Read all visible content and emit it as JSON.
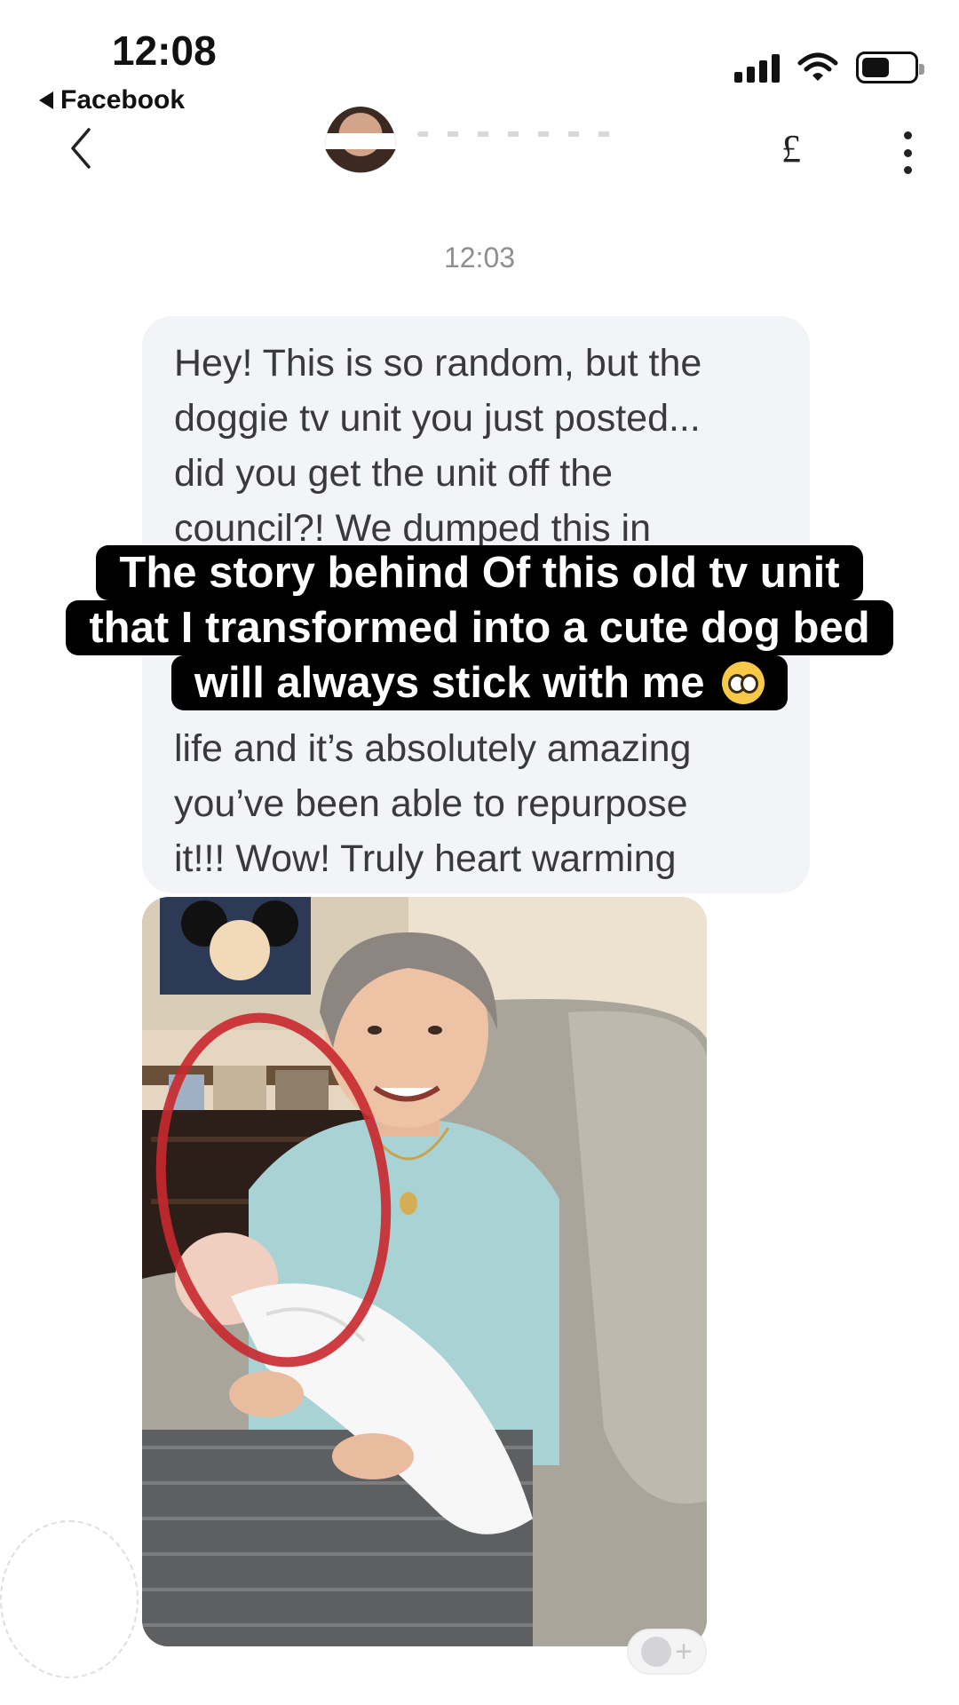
{
  "status_bar": {
    "time": "12:08",
    "back_app": "Facebook",
    "icons": [
      "signal-icon",
      "wifi-icon",
      "battery-icon"
    ]
  },
  "nav": {
    "back_icon": "chevron-left-icon",
    "currency_icon": "£",
    "more_icon": "more-vertical-icon"
  },
  "thread": {
    "timestamp": "12:03",
    "message": "Hey! This is so random, but the\ndoggie tv unit you just posted...\ndid you get the unit off the\ncouncil?! We dumped this in\n\n\n\nlife and it’s absolutely amazing\nyou’ve been able to repurpose\nit!!! Wow! Truly heart warming",
    "reaction_add": "+"
  },
  "caption": {
    "line1": "The story behind Of this old tv unit",
    "line2": "that I transformed into a cute dog bed",
    "line3": "will always stick with me",
    "emoji": "pleading-face-emoji"
  },
  "colors": {
    "bubble": "#f2f4f7",
    "caption_bg": "#000000",
    "caption_text": "#ffffff",
    "timestamp": "#8e8e93",
    "circle_annotation": "#c8282d"
  }
}
